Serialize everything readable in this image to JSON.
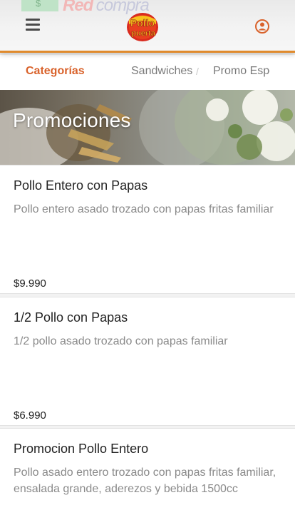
{
  "header": {
    "banner_left": "$",
    "banner_red": "Red",
    "banner_compra": "compra",
    "logo_line1": "Pollo",
    "logo_line2": "puerta",
    "accent": "#d9622b"
  },
  "tabs": {
    "items": [
      {
        "label": "Categorías",
        "active": true
      },
      {
        "label": "Sandwiches",
        "active": false
      },
      {
        "label": "Promo Especial",
        "active": false
      }
    ],
    "separator": "/"
  },
  "promo_banner": {
    "title": "Promociones"
  },
  "products": [
    {
      "name": "Pollo Entero con Papas",
      "description": "Pollo entero asado trozado con papas fritas familiar",
      "price": "$9.990"
    },
    {
      "name": "1/2 Pollo con Papas",
      "description": "1/2 pollo asado trozado con papas familiar",
      "price": "$6.990"
    },
    {
      "name": "Promocion Pollo Entero",
      "description": "Pollo asado entero trozado con papas fritas familiar, ensalada grande, aderezos y bebida 1500cc",
      "price": ""
    }
  ]
}
